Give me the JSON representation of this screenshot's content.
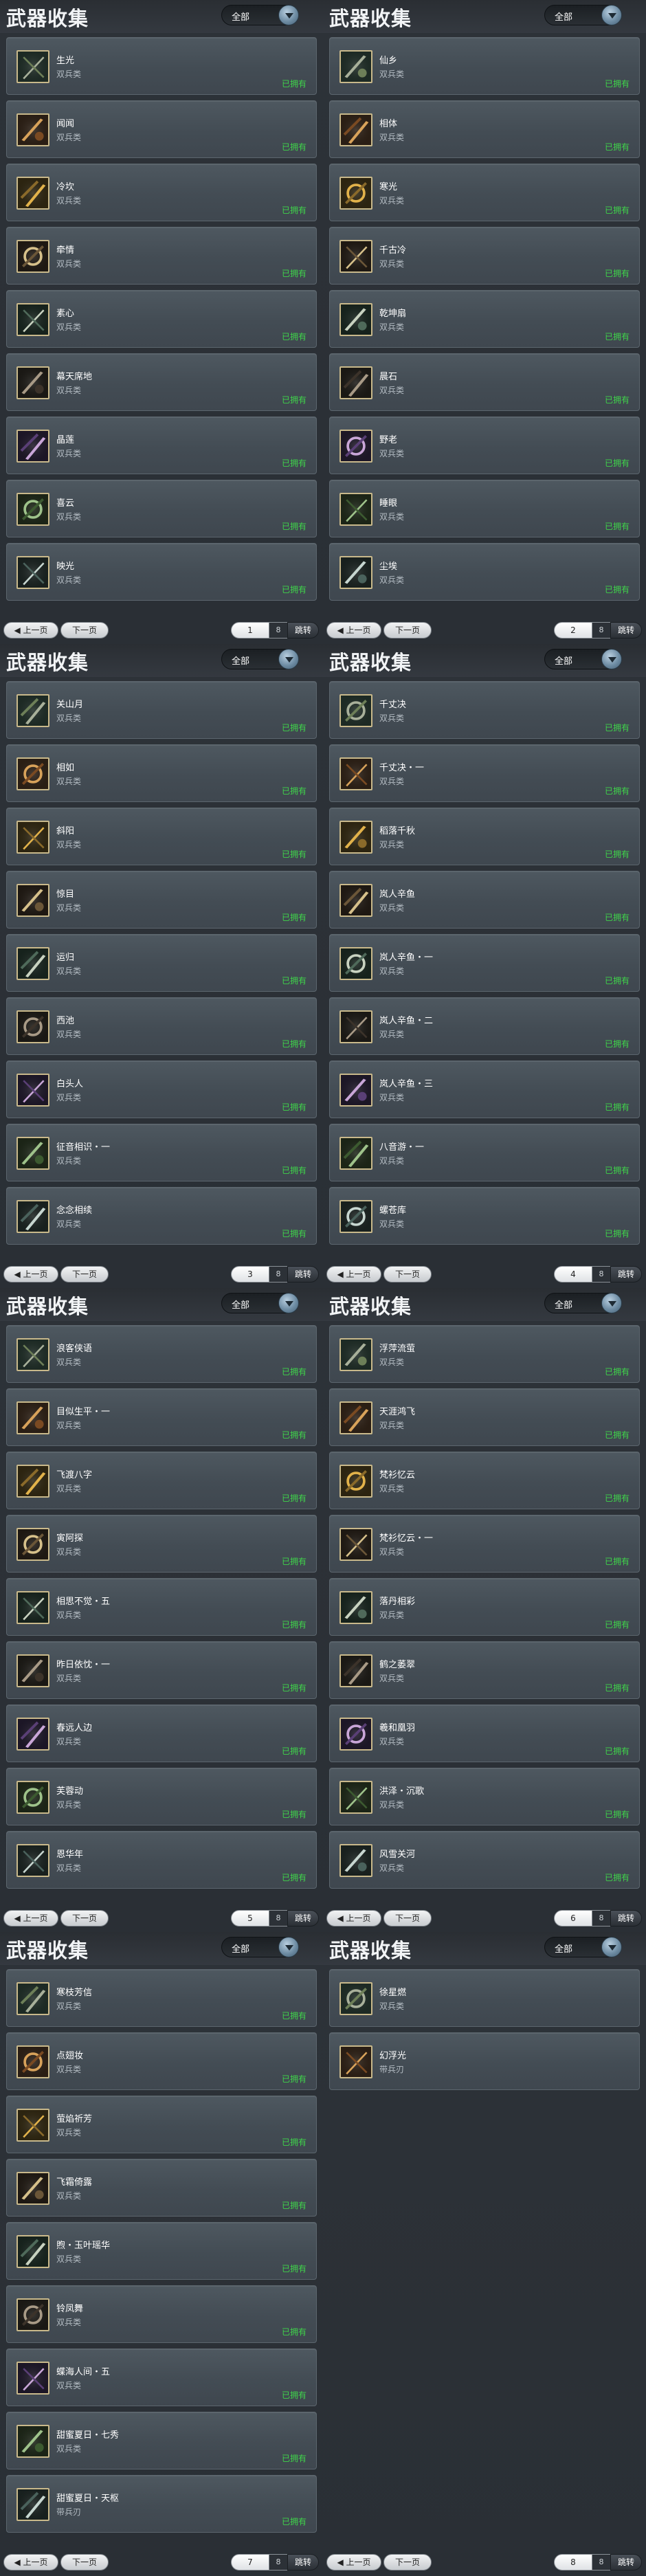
{
  "common": {
    "title": "武器收集",
    "filter_label": "全部",
    "type_label": "双兵类",
    "status_label": "已拥有",
    "prev_label": "上一页",
    "next_label": "下一页",
    "goto_label": "跳转",
    "total_pages": "8"
  },
  "panels": [
    {
      "page": "1",
      "items": [
        {
          "name": "生光",
          "type": "双兵类",
          "status": "已拥有",
          "icon": "weapon-icon-1"
        },
        {
          "name": "闻闻",
          "type": "双兵类",
          "status": "已拥有",
          "icon": "weapon-icon-2"
        },
        {
          "name": "冷坎",
          "type": "双兵类",
          "status": "已拥有",
          "icon": "weapon-icon-3"
        },
        {
          "name": "牵情",
          "type": "双兵类",
          "status": "已拥有",
          "icon": "weapon-icon-4"
        },
        {
          "name": "素心",
          "type": "双兵类",
          "status": "已拥有",
          "icon": "weapon-icon-5"
        },
        {
          "name": "幕天席地",
          "type": "双兵类",
          "status": "已拥有",
          "icon": "weapon-icon-6"
        },
        {
          "name": "晶莲",
          "type": "双兵类",
          "status": "已拥有",
          "icon": "weapon-icon-7"
        },
        {
          "name": "喜云",
          "type": "双兵类",
          "status": "已拥有",
          "icon": "weapon-icon-8"
        },
        {
          "name": "映光",
          "type": "双兵类",
          "status": "已拥有",
          "icon": "weapon-icon-9"
        }
      ]
    },
    {
      "page": "2",
      "items": [
        {
          "name": "仙乡",
          "type": "双兵类",
          "status": "已拥有",
          "icon": "weapon-icon-10"
        },
        {
          "name": "相体",
          "type": "双兵类",
          "status": "已拥有",
          "icon": "weapon-icon-11"
        },
        {
          "name": "寒光",
          "type": "双兵类",
          "status": "已拥有",
          "icon": "weapon-icon-12"
        },
        {
          "name": "千古冷",
          "type": "双兵类",
          "status": "已拥有",
          "icon": "weapon-icon-13"
        },
        {
          "name": "乾坤扇",
          "type": "双兵类",
          "status": "已拥有",
          "icon": "weapon-icon-14"
        },
        {
          "name": "晨石",
          "type": "双兵类",
          "status": "已拥有",
          "icon": "weapon-icon-15"
        },
        {
          "name": "野老",
          "type": "双兵类",
          "status": "已拥有",
          "icon": "weapon-icon-16"
        },
        {
          "name": "睡眼",
          "type": "双兵类",
          "status": "已拥有",
          "icon": "weapon-icon-17"
        },
        {
          "name": "尘埃",
          "type": "双兵类",
          "status": "已拥有",
          "icon": "weapon-icon-18"
        }
      ]
    },
    {
      "page": "3",
      "items": [
        {
          "name": "关山月",
          "type": "双兵类",
          "status": "已拥有",
          "icon": "weapon-icon-19"
        },
        {
          "name": "相如",
          "type": "双兵类",
          "status": "已拥有",
          "icon": "weapon-icon-20"
        },
        {
          "name": "斜阳",
          "type": "双兵类",
          "status": "已拥有",
          "icon": "weapon-icon-21"
        },
        {
          "name": "惊目",
          "type": "双兵类",
          "status": "已拥有",
          "icon": "weapon-icon-22"
        },
        {
          "name": "运归",
          "type": "双兵类",
          "status": "已拥有",
          "icon": "weapon-icon-23"
        },
        {
          "name": "西池",
          "type": "双兵类",
          "status": "已拥有",
          "icon": "weapon-icon-24"
        },
        {
          "name": "白头人",
          "type": "双兵类",
          "status": "已拥有",
          "icon": "weapon-icon-25"
        },
        {
          "name": "征音相识・一",
          "type": "双兵类",
          "status": "已拥有",
          "icon": "weapon-icon-26"
        },
        {
          "name": "念念相续",
          "type": "双兵类",
          "status": "已拥有",
          "icon": "weapon-icon-27"
        }
      ]
    },
    {
      "page": "4",
      "items": [
        {
          "name": "千丈决",
          "type": "双兵类",
          "status": "已拥有",
          "icon": "weapon-icon-28"
        },
        {
          "name": "千丈决・一",
          "type": "双兵类",
          "status": "已拥有",
          "icon": "weapon-icon-29"
        },
        {
          "name": "稻落千秋",
          "type": "双兵类",
          "status": "已拥有",
          "icon": "weapon-icon-30"
        },
        {
          "name": "岚人辛鱼",
          "type": "双兵类",
          "status": "已拥有",
          "icon": "weapon-icon-31"
        },
        {
          "name": "岚人辛鱼・一",
          "type": "双兵类",
          "status": "已拥有",
          "icon": "weapon-icon-32"
        },
        {
          "name": "岚人辛鱼・二",
          "type": "双兵类",
          "status": "已拥有",
          "icon": "weapon-icon-33"
        },
        {
          "name": "岚人辛鱼・三",
          "type": "双兵类",
          "status": "已拥有",
          "icon": "weapon-icon-34"
        },
        {
          "name": "八音游・一",
          "type": "双兵类",
          "status": "已拥有",
          "icon": "weapon-icon-35"
        },
        {
          "name": "螺苍库",
          "type": "双兵类",
          "status": "已拥有",
          "icon": "weapon-icon-36"
        }
      ]
    },
    {
      "page": "5",
      "items": [
        {
          "name": "浪客侠语",
          "type": "双兵类",
          "status": "已拥有",
          "icon": "weapon-icon-37"
        },
        {
          "name": "目似生平・一",
          "type": "双兵类",
          "status": "已拥有",
          "icon": "weapon-icon-38"
        },
        {
          "name": "飞渡八字",
          "type": "双兵类",
          "status": "已拥有",
          "icon": "weapon-icon-39"
        },
        {
          "name": "寅阿探",
          "type": "双兵类",
          "status": "已拥有",
          "icon": "weapon-icon-40"
        },
        {
          "name": "相思不觉・五",
          "type": "双兵类",
          "status": "已拥有",
          "icon": "weapon-icon-41"
        },
        {
          "name": "昨日依忱・一",
          "type": "双兵类",
          "status": "已拥有",
          "icon": "weapon-icon-42"
        },
        {
          "name": "春远人边",
          "type": "双兵类",
          "status": "已拥有",
          "icon": "weapon-icon-43"
        },
        {
          "name": "芙蓉动",
          "type": "双兵类",
          "status": "已拥有",
          "icon": "weapon-icon-44"
        },
        {
          "name": "恩华年",
          "type": "双兵类",
          "status": "已拥有",
          "icon": "weapon-icon-45"
        }
      ]
    },
    {
      "page": "6",
      "items": [
        {
          "name": "浮萍流萤",
          "type": "双兵类",
          "status": "已拥有",
          "icon": "weapon-icon-46"
        },
        {
          "name": "天涯鸿飞",
          "type": "双兵类",
          "status": "已拥有",
          "icon": "weapon-icon-47"
        },
        {
          "name": "梵衫忆云",
          "type": "双兵类",
          "status": "已拥有",
          "icon": "weapon-icon-48"
        },
        {
          "name": "梵衫忆云・一",
          "type": "双兵类",
          "status": "已拥有",
          "icon": "weapon-icon-49"
        },
        {
          "name": "落丹相彩",
          "type": "双兵类",
          "status": "已拥有",
          "icon": "weapon-icon-50"
        },
        {
          "name": "鹤之萎翠",
          "type": "双兵类",
          "status": "已拥有",
          "icon": "weapon-icon-51"
        },
        {
          "name": "羲和凰羽",
          "type": "双兵类",
          "status": "已拥有",
          "icon": "weapon-icon-52"
        },
        {
          "name": "洪泽・沉歌",
          "type": "双兵类",
          "status": "已拥有",
          "icon": "weapon-icon-53"
        },
        {
          "name": "风雪关河",
          "type": "双兵类",
          "status": "已拥有",
          "icon": "weapon-icon-54"
        }
      ]
    },
    {
      "page": "7",
      "items": [
        {
          "name": "寒枝芳信",
          "type": "双兵类",
          "status": "已拥有",
          "icon": "weapon-icon-55"
        },
        {
          "name": "点翅妆",
          "type": "双兵类",
          "status": "已拥有",
          "icon": "weapon-icon-56"
        },
        {
          "name": "萤焰祈芳",
          "type": "双兵类",
          "status": "已拥有",
          "icon": "weapon-icon-57"
        },
        {
          "name": "飞霜倚露",
          "type": "双兵类",
          "status": "已拥有",
          "icon": "weapon-icon-58"
        },
        {
          "name": "煦・玉叶瑶华",
          "type": "双兵类",
          "status": "已拥有",
          "icon": "weapon-icon-59"
        },
        {
          "name": "铃凤舞",
          "type": "双兵类",
          "status": "已拥有",
          "icon": "weapon-icon-60"
        },
        {
          "name": "蝶海人间・五",
          "type": "双兵类",
          "status": "已拥有",
          "icon": "weapon-icon-61"
        },
        {
          "name": "甜蜜夏日・七秀",
          "type": "双兵类",
          "status": "已拥有",
          "icon": "weapon-icon-62"
        },
        {
          "name": "甜蜜夏日・天枢",
          "type": "带兵刃",
          "status": "已拥有",
          "icon": "weapon-icon-63"
        }
      ]
    },
    {
      "page": "8",
      "items": [
        {
          "name": "徐星燃",
          "type": "双兵类",
          "status": "",
          "icon": "weapon-icon-64"
        },
        {
          "name": "幻浮光",
          "type": "带兵刃",
          "status": "",
          "icon": "weapon-icon-65"
        }
      ]
    }
  ]
}
